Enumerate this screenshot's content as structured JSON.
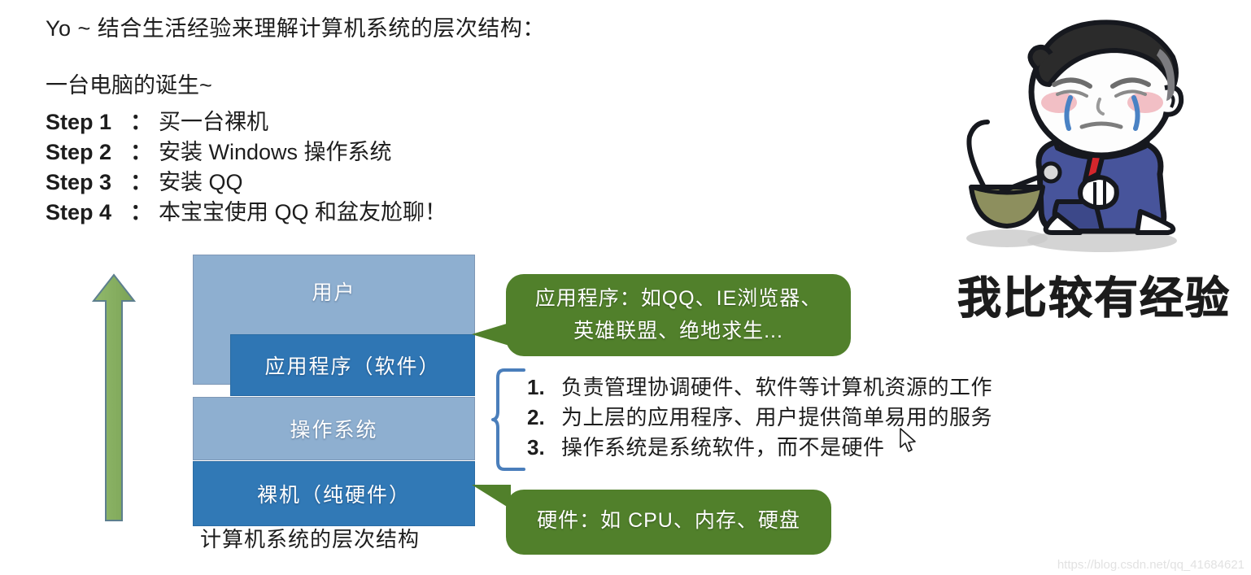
{
  "slide": {
    "headline": "Yo ~ 结合生活经验来理解计算机系统的层次结构：",
    "sub_title": "一台电脑的诞生~",
    "watermark": "https://blog.csdn.net/qq_41684621"
  },
  "steps": [
    {
      "key": "Step 1",
      "colon": "：",
      "text": "买一台裸机"
    },
    {
      "key": "Step 2",
      "colon": "：",
      "text": "安装 Windows 操作系统"
    },
    {
      "key": "Step 3",
      "colon": "：",
      "text": "安装 QQ"
    },
    {
      "key": "Step 4",
      "colon": "：",
      "text": "本宝宝使用 QQ 和盆友尬聊！"
    }
  ],
  "stack": {
    "caption": "计算机系统的层次结构",
    "layers": [
      {
        "label": "用户",
        "color": "#8eafd0"
      },
      {
        "label": "应用程序（软件）",
        "color": "#2f76b4"
      },
      {
        "label": "操作系统",
        "color": "#8eafd0"
      },
      {
        "label": "裸机（纯硬件）",
        "color": "#3179b6"
      }
    ]
  },
  "callouts": {
    "application": {
      "line1": "应用程序：如QQ、IE浏览器、",
      "line2": "英雄联盟、绝地求生...",
      "color": "#51802b"
    },
    "hardware": {
      "line1": "硬件：如 CPU、内存、硬盘",
      "color": "#51802b"
    }
  },
  "os_notes": [
    {
      "num": "1.",
      "text": "负责管理协调硬件、软件等计算机资源的工作"
    },
    {
      "num": "2.",
      "text": "为上层的应用程序、用户提供简单易用的服务"
    },
    {
      "num": "3.",
      "text": "操作系统是系统软件，而不是硬件"
    }
  ],
  "meme": {
    "caption": "我比较有经验",
    "alt": "crying-cartoon-boy"
  },
  "colors": {
    "arrow_green": "#82ad5c",
    "brace_blue": "#4a7ebb",
    "layer_light_blue": "#8eafd0",
    "layer_dark_blue": "#2f76b4",
    "callout_green": "#51802b"
  }
}
